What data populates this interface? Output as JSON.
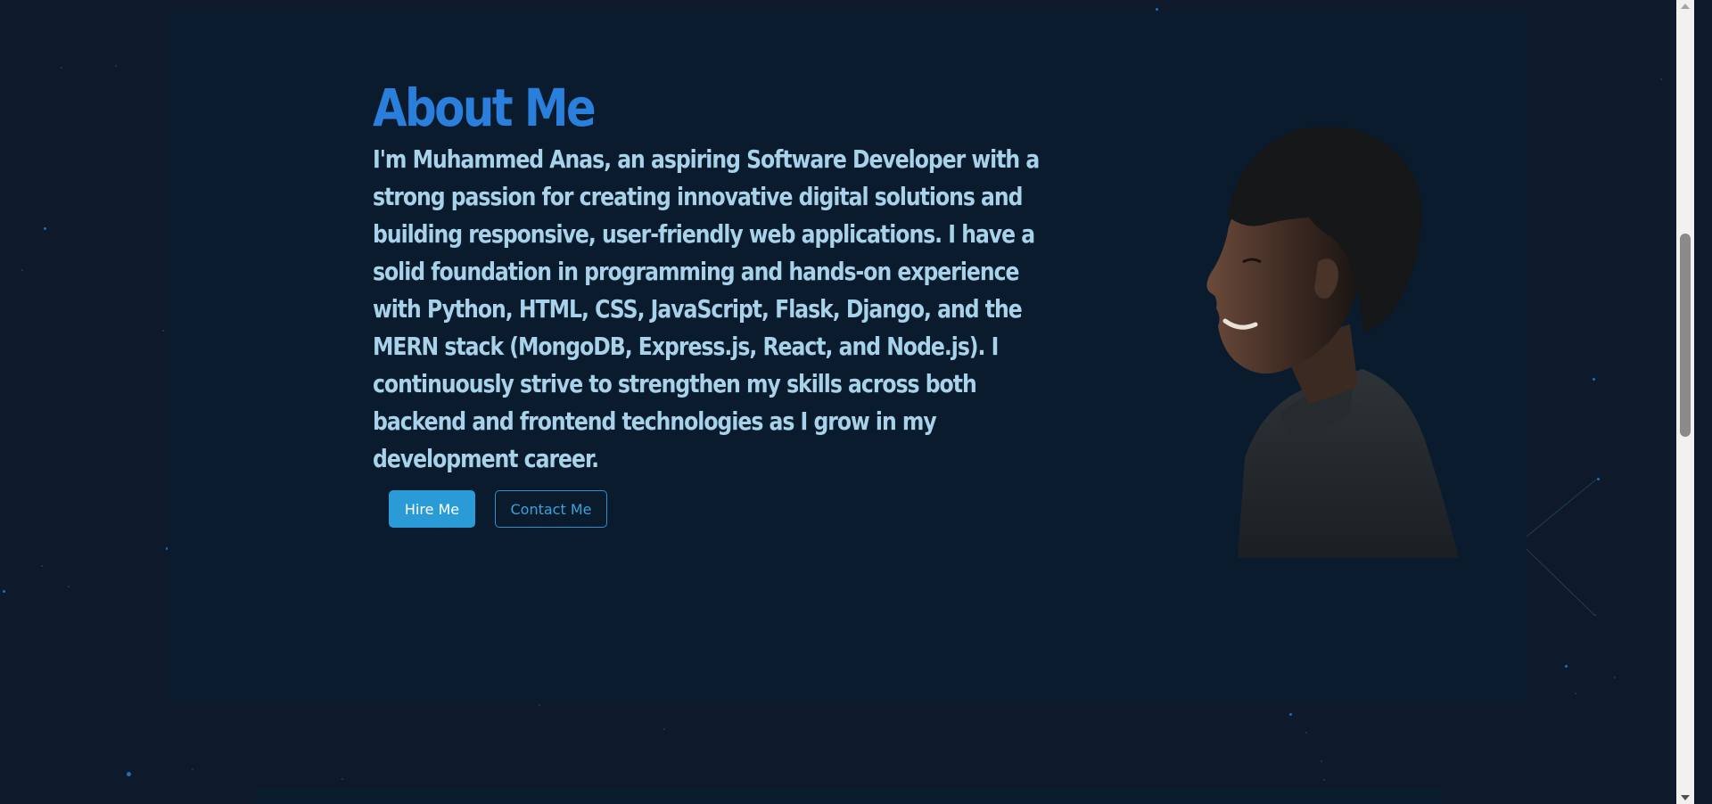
{
  "about": {
    "title": "About Me",
    "body": "I'm Muhammed Anas, an aspiring Software Developer with a strong passion for creating innovative digital solutions and building responsive, user-friendly web applications. I have a solid foundation in programming and hands-on experience with Python, HTML, CSS, JavaScript, Flask, Django, and the MERN stack (MongoDB, Express.js, React, and Node.js). I continuously strive to strengthen my skills across both backend and frontend technologies as I grow in my development career.",
    "portrait_alt": "profile-photo"
  },
  "buttons": {
    "hire_label": "Hire Me",
    "contact_label": "Contact Me"
  },
  "colors": {
    "background": "#0e1a2b",
    "section_background": "#091b2c",
    "title_color": "#2a7fdc",
    "body_color": "#a7d2ea",
    "primary_button": "#2a9bd7",
    "outline_button": "#2f8fcf",
    "star_color": "#1f7fd1"
  }
}
